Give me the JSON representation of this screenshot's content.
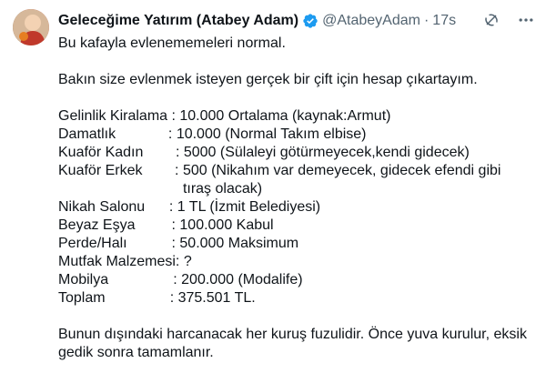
{
  "author": {
    "name": "Geleceğime Yatırım (Atabey Adam)",
    "handle": "@AtabeyAdam",
    "separator": "·",
    "time": "17s"
  },
  "icons": {
    "verified": "verified-badge-icon",
    "grok": "grok-icon",
    "more": "more-icon",
    "accent": "#1d9bf0"
  },
  "tweet": {
    "line1": "Bu kafayla evlenememeleri normal.",
    "line2": "Bakın size evlenmek isteyen gerçek bir çift için hesap çıkartayım.",
    "items": [
      {
        "label": "Gelinlik Kiralama : ",
        "value": "10.000 Ortalama (kaynak:Armut)"
      },
      {
        "label": "Damatlık             : ",
        "value": "10.000 (Normal Takım elbise)"
      },
      {
        "label": "Kuaför Kadın        : ",
        "value": "5000 (Sülaleyi götürmeyecek,kendi gidecek)"
      },
      {
        "label": "Kuaför Erkek        : ",
        "value": "500 (Nikahım var demeyecek, gidecek efendi gibi tıraş olacak)"
      },
      {
        "label": "Nikah Salonu      : ",
        "value": "1 TL (İzmit Belediyesi)"
      },
      {
        "label": "Beyaz Eşya         : ",
        "value": "100.000 Kabul"
      },
      {
        "label": "Perde/Halı           : ",
        "value": "50.000 Maksimum"
      },
      {
        "label": "Mutfak Malzemesi: ",
        "value": "?"
      },
      {
        "label": "Mobilya                : ",
        "value": "200.000 (Modalife)"
      },
      {
        "label": "Toplam                : ",
        "value": "375.501 TL."
      }
    ],
    "closing": "Bunun dışındaki harcanacak her kuruş fuzulidir. Önce yuva kurulur, eksik gedik sonra tamamlanır."
  }
}
